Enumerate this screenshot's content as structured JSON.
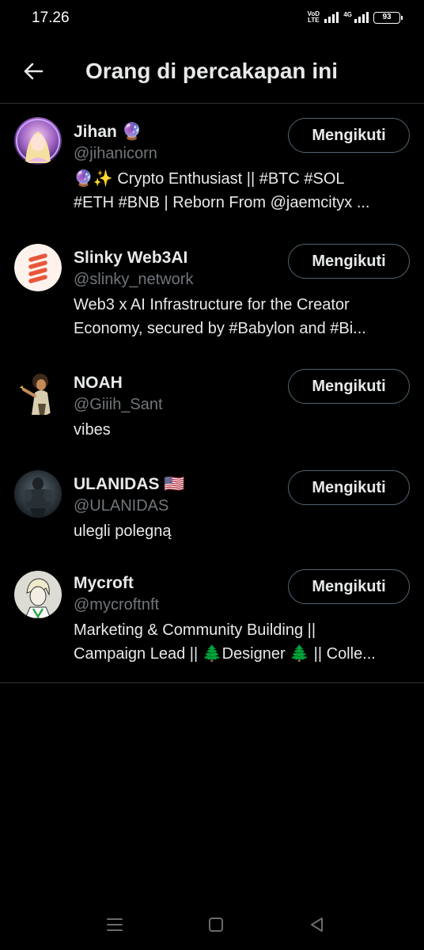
{
  "status_bar": {
    "time": "17.26",
    "volte_line1": "VoD",
    "volte_line2": "LTE",
    "network": "4G",
    "battery": "93"
  },
  "header": {
    "title": "Orang di percakapan ini"
  },
  "users": [
    {
      "name": "Jihan",
      "name_emoji": "🔮",
      "handle": "@jihanicorn",
      "bio_lines": [
        "🔮✨ Crypto Enthusiast || #BTC #SOL",
        "#ETH #BNB | Reborn From @jaemcityx ..."
      ],
      "button": "Mengikuti"
    },
    {
      "name": "Slinky Web3AI",
      "name_emoji": "",
      "handle": "@slinky_network",
      "bio_lines": [
        "Web3 x AI Infrastructure for the Creator",
        "Economy, secured by #Babylon and #Bi..."
      ],
      "button": "Mengikuti"
    },
    {
      "name": "NOAH",
      "name_emoji": "",
      "handle": "@Giiih_Sant",
      "bio_lines": [
        "vibes"
      ],
      "button": "Mengikuti"
    },
    {
      "name": "ULANIDAS",
      "name_emoji": "🇺🇸",
      "handle": "@ULANIDAS",
      "bio_lines": [
        "ulegli polegną"
      ],
      "button": "Mengikuti"
    },
    {
      "name": "Mycroft",
      "name_emoji": "",
      "handle": "@mycroftnft",
      "bio_lines": [
        "Marketing & Community Building ||",
        "Campaign Lead || 🌲Designer 🌲 || Colle..."
      ],
      "button": "Mengikuti"
    }
  ],
  "icons": {
    "back": "arrow-left-icon",
    "nav_recents": "menu-lines-icon",
    "nav_home": "square-icon",
    "nav_back": "triangle-back-icon"
  },
  "colors": {
    "background": "#000000",
    "text": "#e7e9ea",
    "secondary": "#71767b",
    "divider": "#2f3336",
    "button_border": "#536471"
  }
}
